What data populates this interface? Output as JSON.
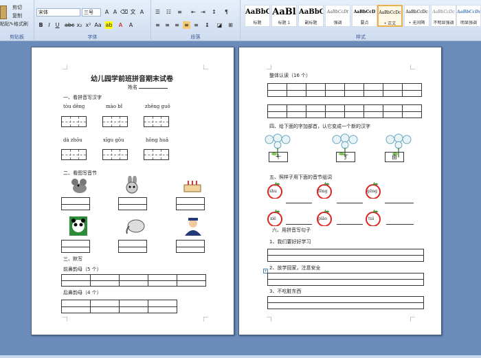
{
  "ribbon": {
    "clipboard": {
      "cut": "剪切",
      "copy": "复制",
      "format_painter": "格式刷",
      "paste": "粘贴",
      "group": "剪贴板"
    },
    "font": {
      "name": "宋体",
      "size": "三号",
      "group": "字体"
    },
    "paragraph": {
      "group": "段落"
    },
    "styles": {
      "group": "样式",
      "items": [
        {
          "preview": "AaBbC",
          "label": "标题"
        },
        {
          "preview": "AaBl",
          "label": "标题 1"
        },
        {
          "preview": "AaBbC",
          "label": "副标题"
        },
        {
          "preview": "AaBbCcDt",
          "label": "强调"
        },
        {
          "preview": "AaBbCcD",
          "label": "要点"
        },
        {
          "preview": "AaBbCcDc",
          "label": "• 正文"
        },
        {
          "preview": "AaBbCcDc",
          "label": "• 无间隔"
        },
        {
          "preview": "AaBbCcDc",
          "label": "不明显强调"
        },
        {
          "preview": "AaBbCcDc",
          "label": "明显强调"
        }
      ]
    }
  },
  "page1": {
    "title": "幼儿园学前班拼音期末试卷",
    "name_label": "姓名",
    "sec1": "一、看拼音写汉字",
    "pinyin_row1": [
      "tòu dēng",
      "mào bǐ",
      "zhēng guǒ"
    ],
    "pinyin_row2": [
      "dà zhōu",
      "xīgu gōu",
      "hōng huā"
    ],
    "sec2": "二、看图写音节",
    "sec3": "三、默写",
    "front_nasal": "前鼻韵母（5 个）",
    "back_nasal": "后鼻韵母（4 个）"
  },
  "page2": {
    "sec_whole": "整体认读（16 个）",
    "sec4": "四、给下面的字加部首，认它变成一个新的汉字",
    "chars": [
      "十",
      "丁",
      "由"
    ],
    "sec5": "五、照样子用下面的音节组词",
    "apples": [
      "shu",
      "fēng",
      "gēng",
      "xiě",
      "piāo",
      "tuì"
    ],
    "sec6": "六、用拼音写句子",
    "sentences": [
      "1、我们要好好学习",
      "2、放学回家，注意安全",
      "3、不吃脏东西"
    ]
  }
}
